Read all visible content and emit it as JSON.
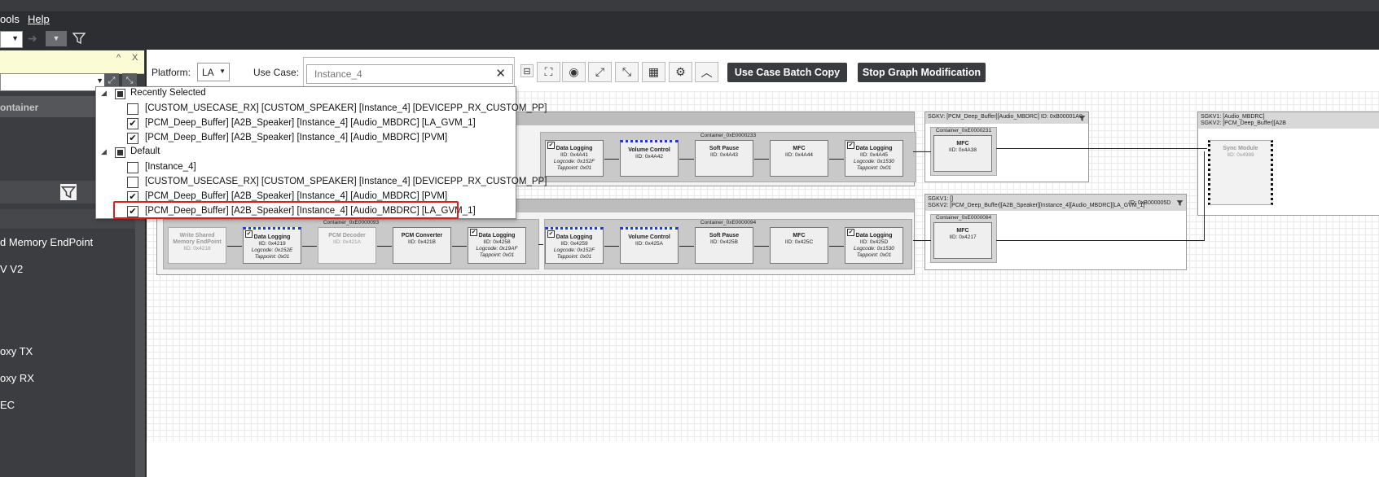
{
  "menubar": {
    "tools": "ools",
    "help": "Help"
  },
  "left_panel": {
    "header": "ontainer",
    "items": [
      "d Memory EndPoint",
      "V V2",
      "oxy TX",
      "oxy RX",
      "EC"
    ]
  },
  "top": {
    "platform_label": "Platform:",
    "platform_value": "LA",
    "use_case_label": "Use Case:",
    "use_case_value": "Instance_4",
    "batch_copy": "Use Case Batch Copy",
    "stop_graph": "Stop Graph Modification"
  },
  "popup": {
    "groups": [
      {
        "label": "Recently Selected",
        "items": [
          {
            "text": "[CUSTOM_USECASE_RX] [CUSTOM_SPEAKER] [Instance_4] [DEVICEPP_RX_CUSTOM_PP]",
            "checked": false
          },
          {
            "text": "[PCM_Deep_Buffer] [A2B_Speaker] [Instance_4] [Audio_MBDRC] [LA_GVM_1]",
            "checked": true
          },
          {
            "text": "[PCM_Deep_Buffer] [A2B_Speaker] [Instance_4] [Audio_MBDRC] [PVM]",
            "checked": true
          }
        ]
      },
      {
        "label": "Default",
        "items": [
          {
            "text": "[Instance_4]",
            "checked": false
          },
          {
            "text": "[CUSTOM_USECASE_RX] [CUSTOM_SPEAKER] [Instance_4] [DEVICEPP_RX_CUSTOM_PP]",
            "checked": false
          },
          {
            "text": "[PCM_Deep_Buffer] [A2B_Speaker] [Instance_4] [Audio_MBDRC] [PVM]",
            "checked": true
          },
          {
            "text": "[PCM_Deep_Buffer] [A2B_Speaker] [Instance_4] [Audio_MBDRC] [LA_GVM_1]",
            "checked": true
          }
        ]
      }
    ]
  },
  "graph": {
    "row1": {
      "container": "Container_0xE0000233",
      "modules": [
        {
          "name": "Data Logging",
          "iid": "IID: 0x4A41",
          "logcode": "Logcode: 0x152F",
          "tap": "Tappoint: 0x01"
        },
        {
          "name": "Volume Control",
          "iid": "IID: 0x4A42"
        },
        {
          "name": "Soft Pause",
          "iid": "IID: 0x4A43"
        },
        {
          "name": "MFC",
          "iid": "IID: 0x4A44"
        },
        {
          "name": "Data Logging",
          "iid": "IID: 0x4A45",
          "logcode": "Logcode: 0x1530",
          "tap": "Tappoint: 0x01"
        }
      ]
    },
    "sg_right1": {
      "head": "SGKV: [PCM_Deep_Buffer][Audio_MBDRC] ID: 0xB00001A0",
      "container": "Container_0xE0000231",
      "module": {
        "name": "MFC",
        "iid": "IID: 0x4A38"
      }
    },
    "sg_right2": {
      "head1": "SGKV1: []",
      "head2": "SGKV2: [PCM_Deep_Buffer][A2B_Speaker][Instance_4][Audio_MBDRC][LA_GVM_1]",
      "id": "ID: 0xB000005D",
      "container": "Container_0xE0000084",
      "module": {
        "name": "MFC",
        "iid": "IID: 0x4217"
      }
    },
    "sg_far": {
      "head1": "SGKV1: [Audio_MBDRC]",
      "head2": "SGKV2: [PCM_Deep_Buffer][A2B",
      "module": {
        "name": "Sync Module",
        "iid": "IID: 0x4989"
      }
    },
    "row2": {
      "container_a": "Container_0xE0000093",
      "container_b": "Container_0xE0000094",
      "modules_a": [
        {
          "name": "Write Shared Memory EndPoint",
          "iid": "IID: 0x4218"
        },
        {
          "name": "Data Logging",
          "iid": "IID: 0x4219",
          "logcode": "Logcode: 0x152E",
          "tap": "Tappoint: 0x01"
        },
        {
          "name": "PCM Decoder",
          "iid": "IID: 0x421A"
        },
        {
          "name": "PCM Converter",
          "iid": "IID: 0x421B"
        },
        {
          "name": "Data Logging",
          "iid": "IID: 0x4258",
          "logcode": "Logcode: 0x19AF",
          "tap": "Tappoint: 0x01"
        }
      ],
      "modules_b": [
        {
          "name": "Data Logging",
          "iid": "IID: 0x4259",
          "logcode": "Logcode: 0x152F",
          "tap": "Tappoint: 0x01"
        },
        {
          "name": "Volume Control",
          "iid": "IID: 0x425A"
        },
        {
          "name": "Soft Pause",
          "iid": "IID: 0x425B"
        },
        {
          "name": "MFC",
          "iid": "IID: 0x425C"
        },
        {
          "name": "Data Logging",
          "iid": "IID: 0x425D",
          "logcode": "Logcode: 0x1530",
          "tap": "Tappoint: 0x01"
        }
      ]
    }
  },
  "colors": {
    "highlight": "#e21b1b",
    "dots": "#1c36e6",
    "chrome": "#2d2e31"
  }
}
